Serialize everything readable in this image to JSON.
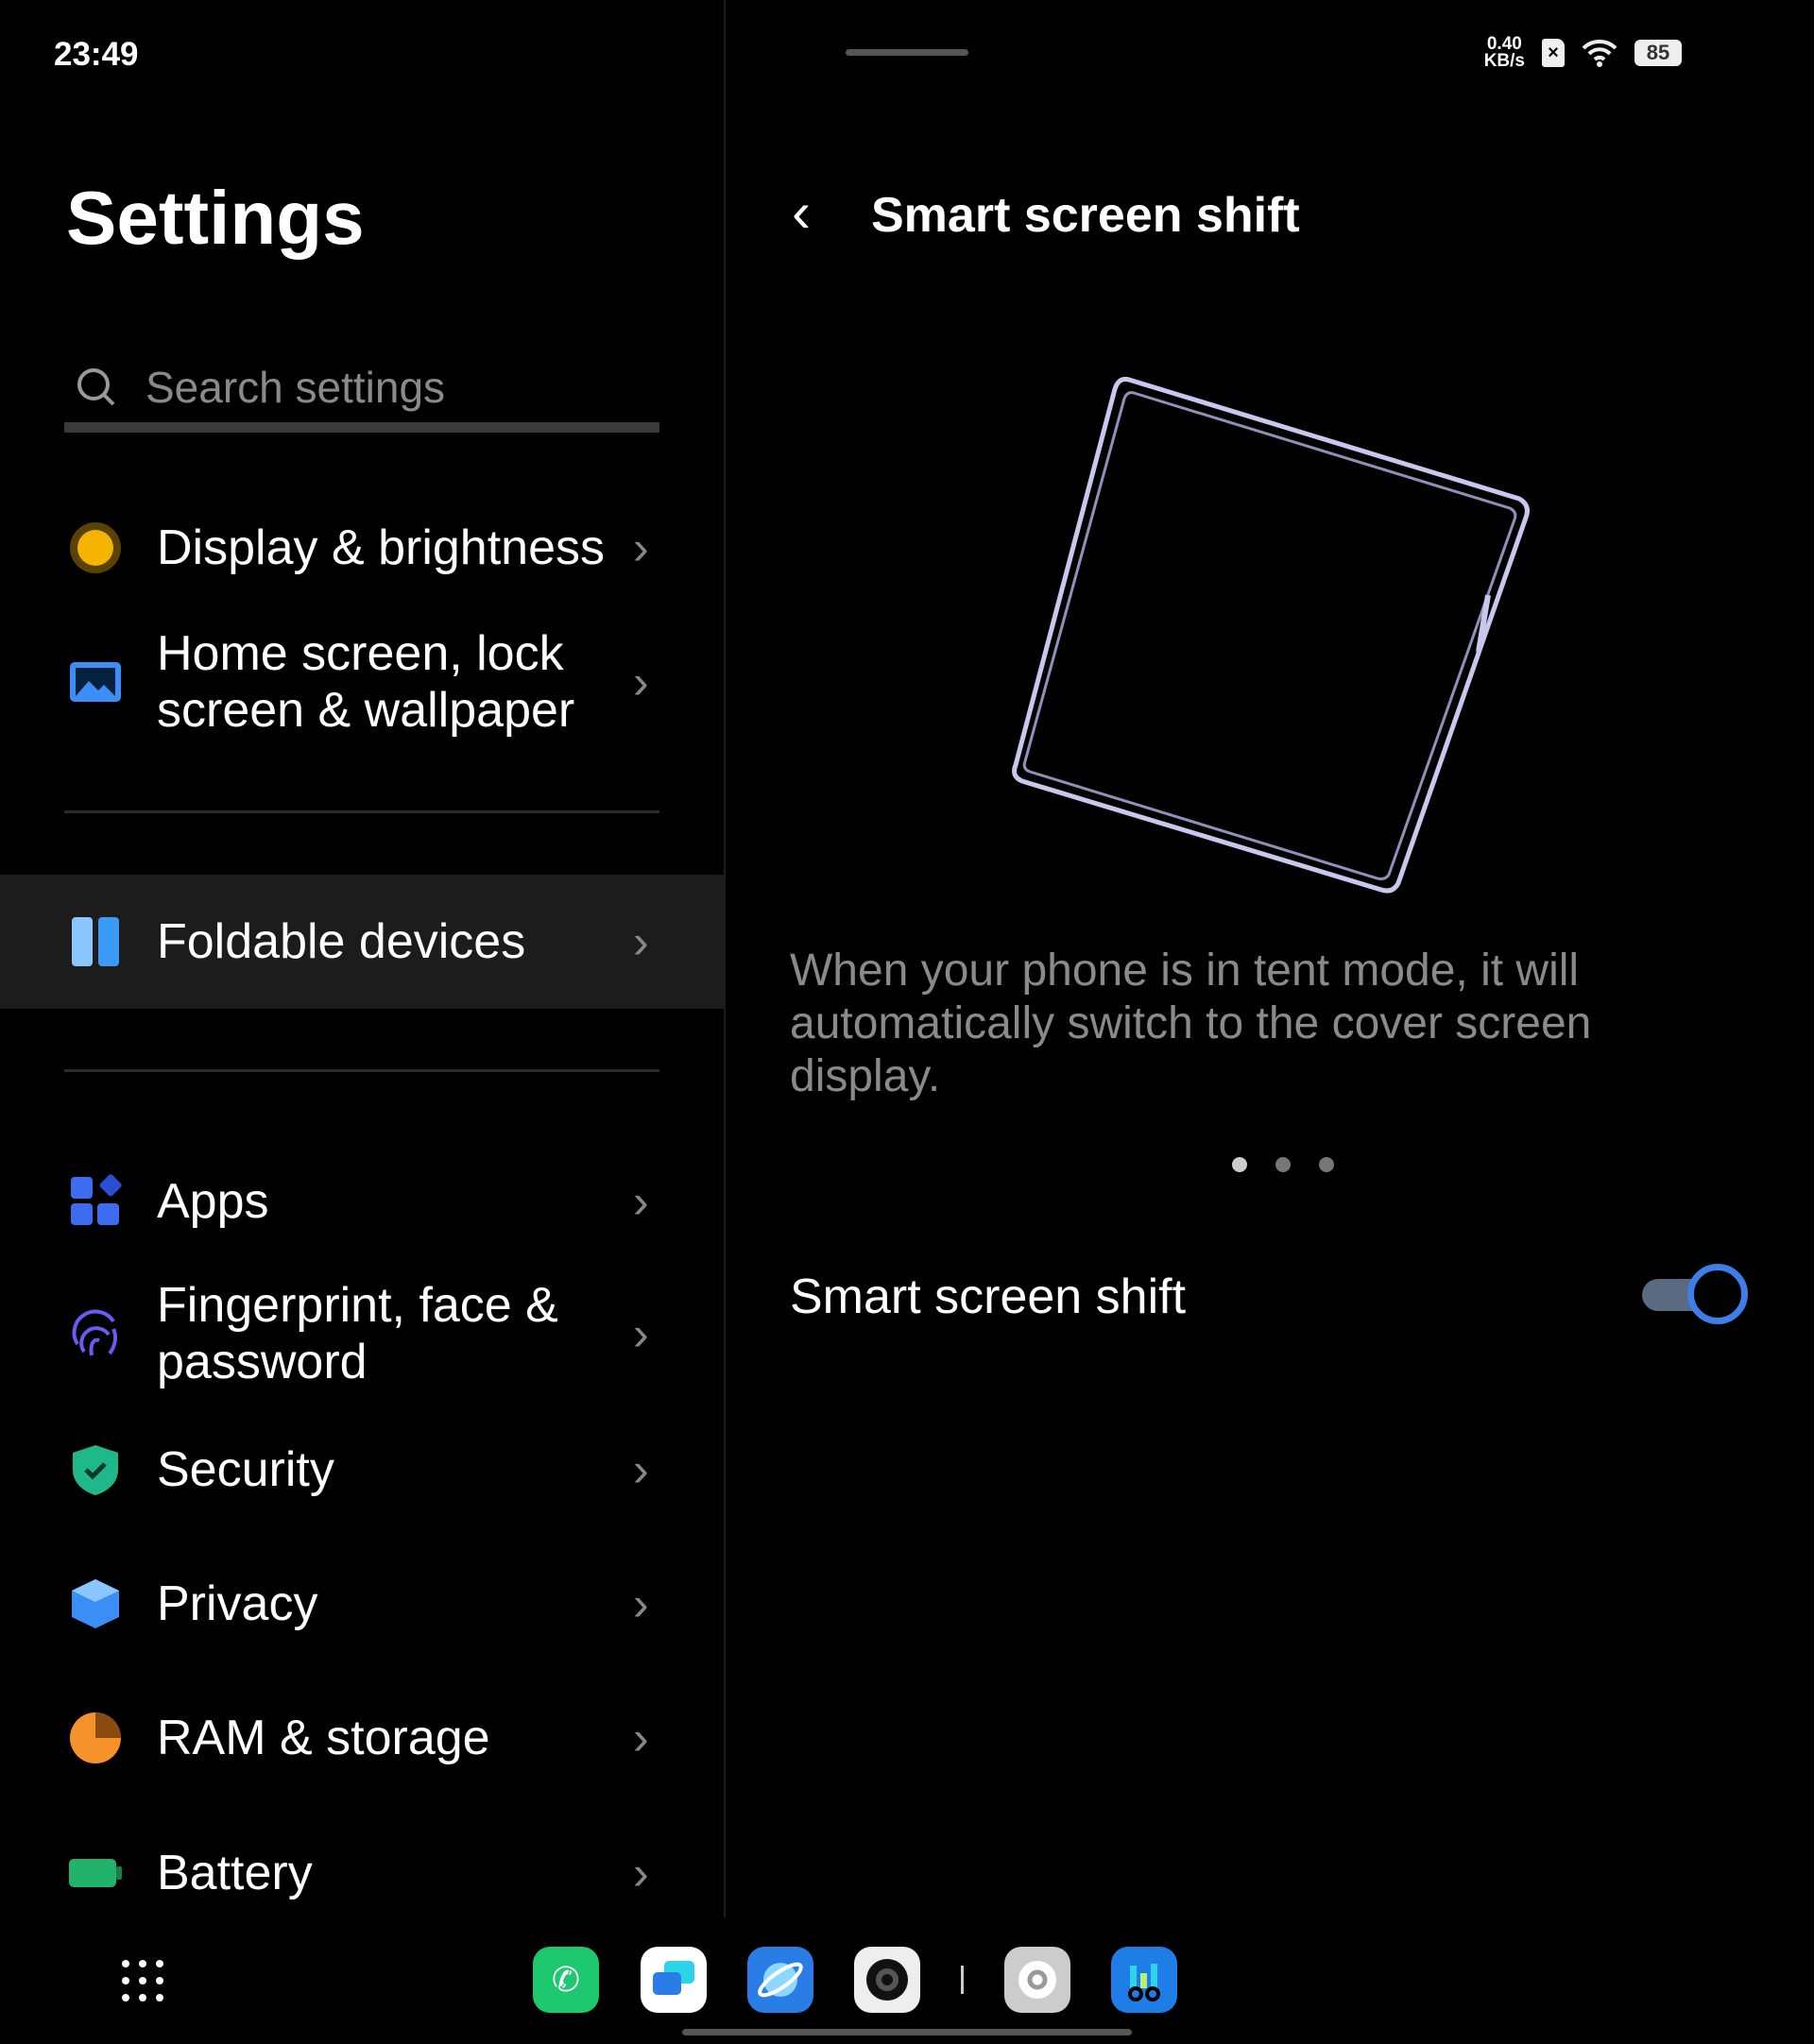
{
  "status": {
    "time": "23:49",
    "speed_value": "0.40",
    "speed_unit": "KB/s",
    "battery": "85",
    "icons": [
      "sim-x-icon",
      "wifi-icon",
      "battery-icon"
    ]
  },
  "left": {
    "title": "Settings",
    "search_placeholder": "Search settings",
    "items": [
      {
        "label": "Display & brightness",
        "icon": "sun-icon",
        "color": "#f5b400"
      },
      {
        "label": "Home screen, lock screen & wallpaper",
        "icon": "wallpaper-icon",
        "color": "#3a8ef5"
      },
      {
        "label": "Foldable devices",
        "icon": "foldable-icon",
        "color": "#3a9af5",
        "selected": true
      },
      {
        "label": "Apps",
        "icon": "apps-icon",
        "color": "#3d6cf0"
      },
      {
        "label": "Fingerprint, face & password",
        "icon": "fingerprint-icon",
        "color": "#6a5cf0"
      },
      {
        "label": "Security",
        "icon": "shield-icon",
        "color": "#1fb88a"
      },
      {
        "label": "Privacy",
        "icon": "privacy-icon",
        "color": "#3a8ef5"
      },
      {
        "label": "RAM & storage",
        "icon": "pie-icon",
        "color": "#f5932a"
      },
      {
        "label": "Battery",
        "icon": "battery-icon",
        "color": "#22b26a"
      }
    ]
  },
  "right": {
    "title": "Smart screen shift",
    "description": "When your phone is in tent mode, it will automatically switch to the cover screen display.",
    "carousel_pages": 3,
    "carousel_active": 1,
    "toggle_label": "Smart screen shift",
    "toggle_on": true,
    "accent": "#3d7ee8"
  },
  "dock": [
    "phone",
    "messages",
    "browser",
    "camera",
    "settings",
    "stats"
  ]
}
